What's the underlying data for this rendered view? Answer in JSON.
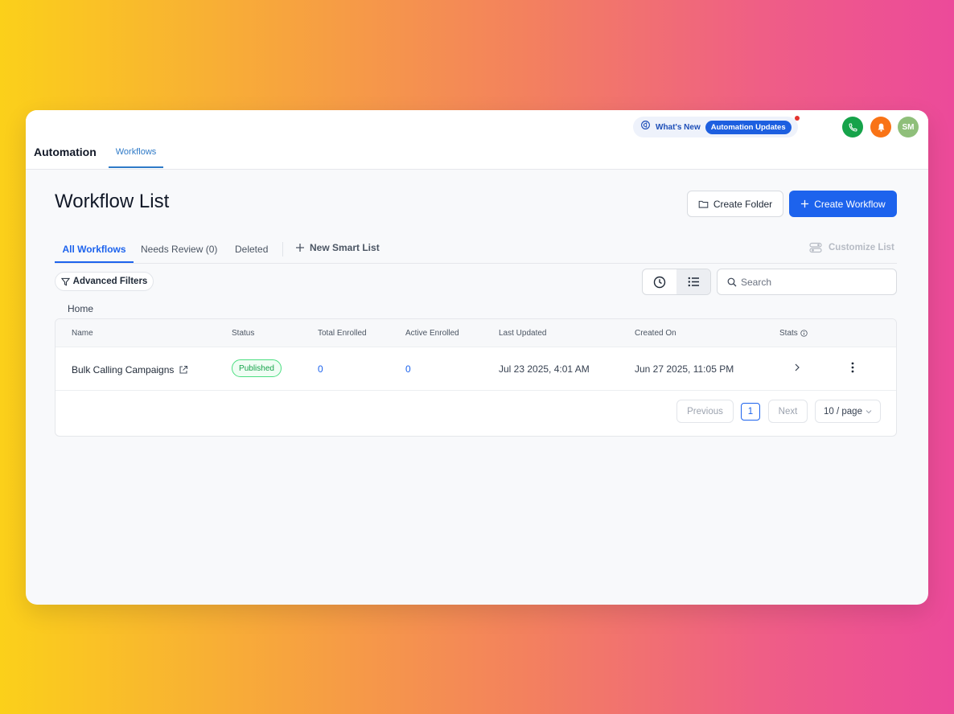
{
  "header": {
    "app_title": "Automation",
    "nav_tab": "Workflows",
    "whats_new_label": "What's New",
    "whats_new_pill": "Automation Updates",
    "avatar_initials": "SM",
    "colors": {
      "phone": "#16a34a",
      "bell": "#f97316",
      "avatar": "#8fbf7a",
      "accent": "#1d63ed"
    }
  },
  "page": {
    "title": "Workflow List",
    "create_folder_label": "Create Folder",
    "create_workflow_label": "Create Workflow"
  },
  "tabs": [
    {
      "label": "All Workflows",
      "active": true
    },
    {
      "label": "Needs Review (0)",
      "active": false
    },
    {
      "label": "Deleted",
      "active": false
    }
  ],
  "new_smart_list_label": "New Smart List",
  "customize_list_label": "Customize List",
  "advanced_filters_label": "Advanced Filters",
  "search": {
    "placeholder": "Search",
    "value": ""
  },
  "breadcrumb": "Home",
  "table": {
    "columns": [
      "Name",
      "Status",
      "Total Enrolled",
      "Active Enrolled",
      "Last Updated",
      "Created On",
      "Stats"
    ],
    "rows": [
      {
        "name": "Bulk Calling Campaigns",
        "status": "Published",
        "total_enrolled": "0",
        "active_enrolled": "0",
        "last_updated": "Jul 23 2025, 4:01 AM",
        "created_on": "Jun 27 2025, 11:05 PM"
      }
    ]
  },
  "pagination": {
    "previous_label": "Previous",
    "current_page": "1",
    "next_label": "Next",
    "per_page_label": "10 / page"
  }
}
